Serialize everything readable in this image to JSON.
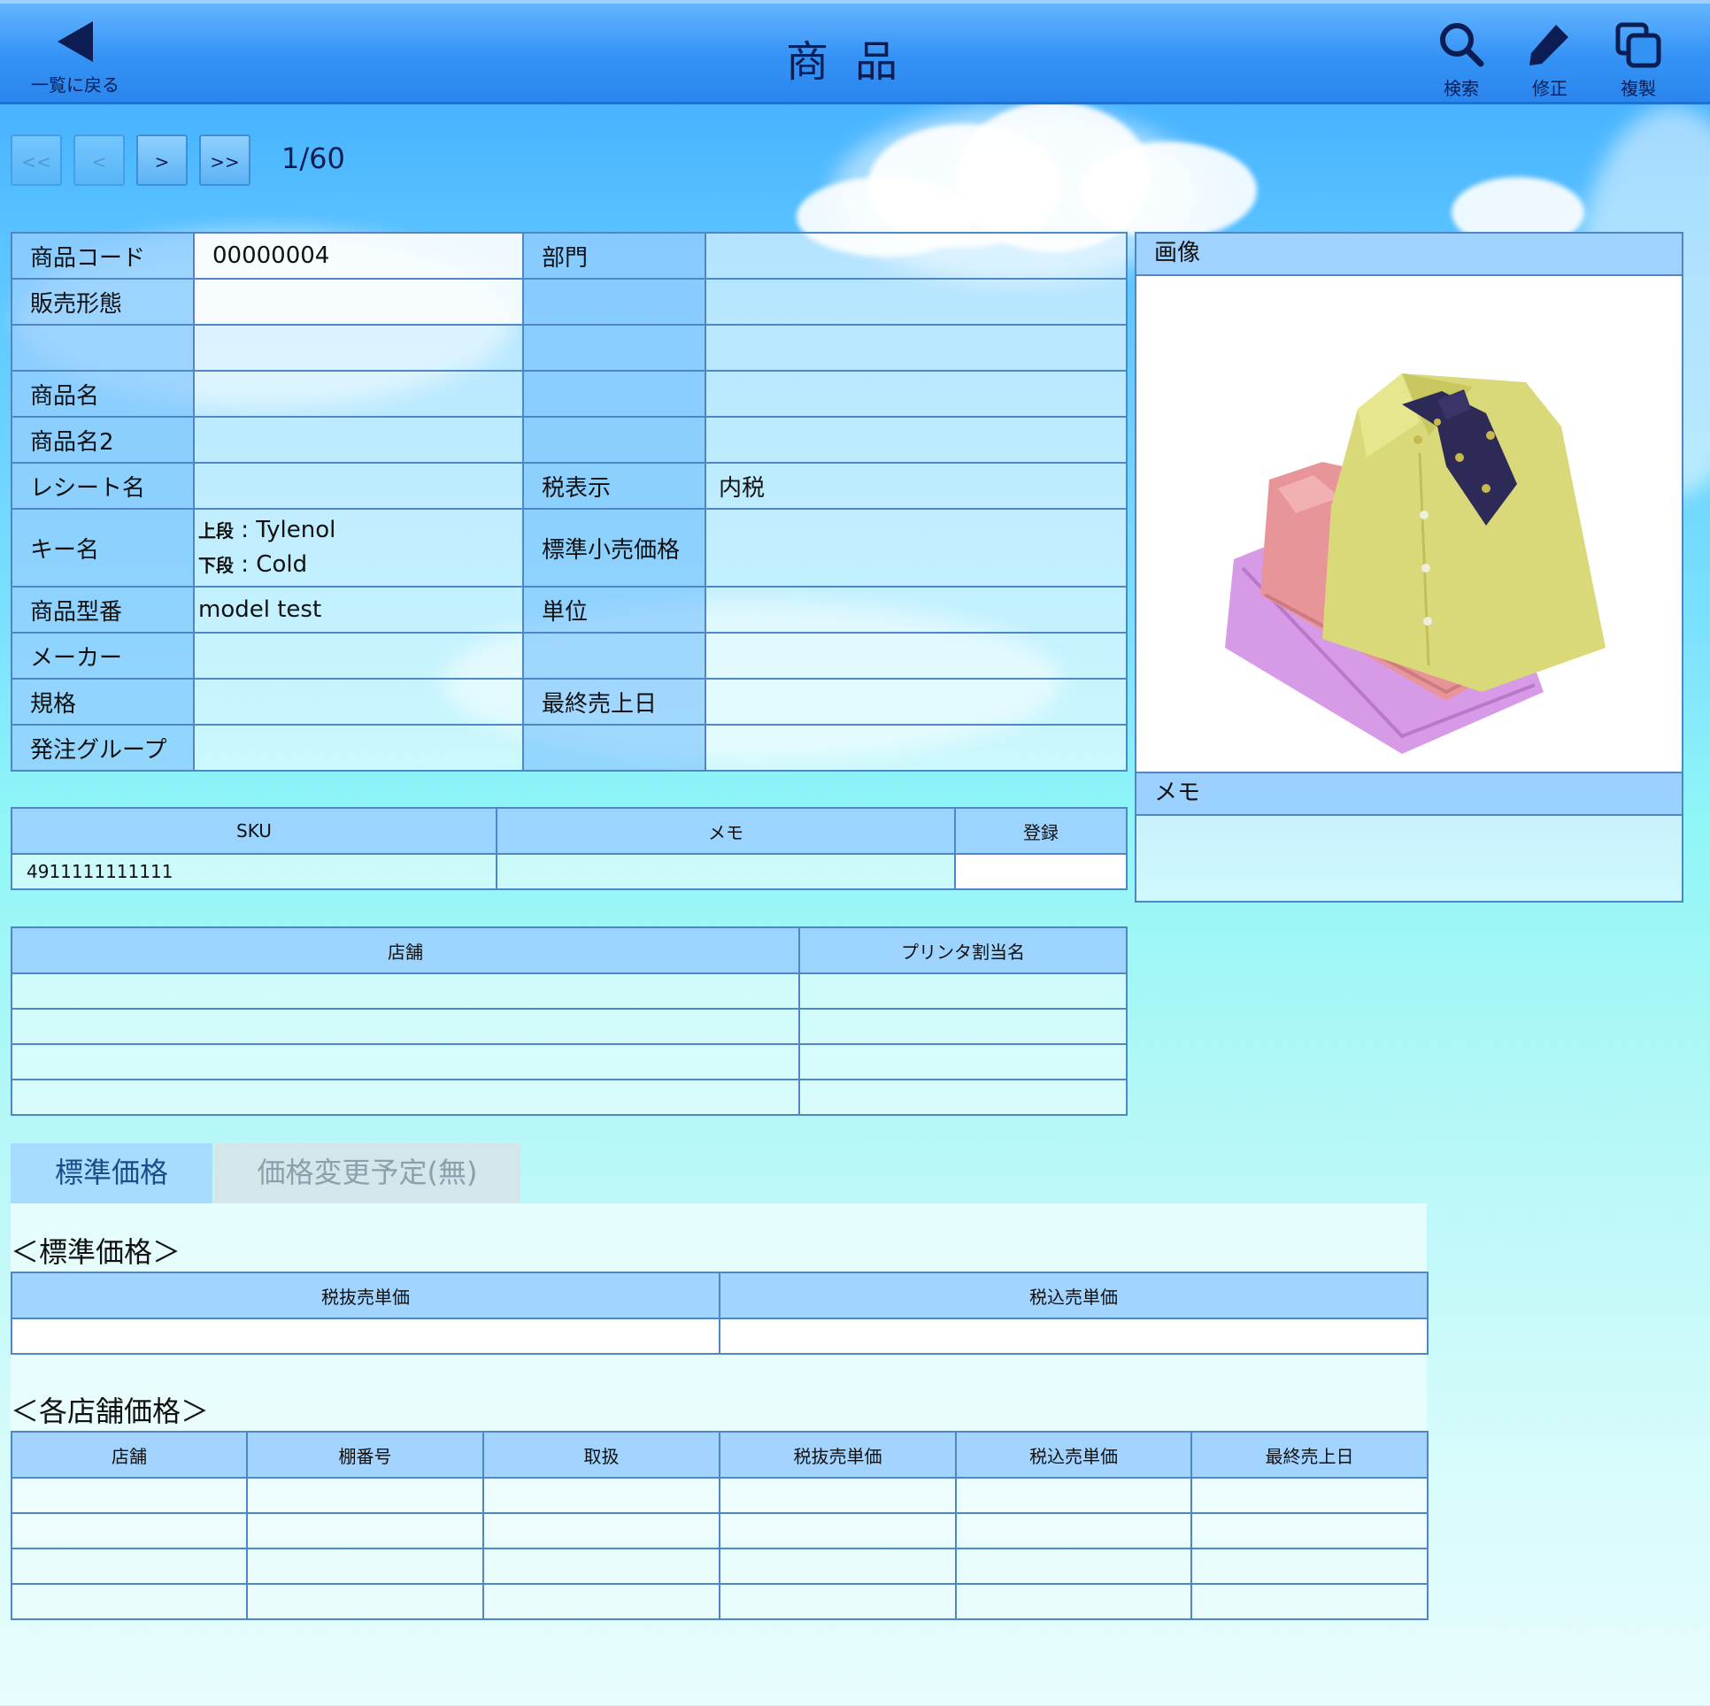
{
  "header": {
    "back_label": "一覧に戻る",
    "title": "商品",
    "search_label": "検索",
    "edit_label": "修正",
    "copy_label": "複製"
  },
  "pager": {
    "first": "<<",
    "prev": "<",
    "next": ">",
    "last": ">>",
    "count": "1/60"
  },
  "product": {
    "code_label": "商品コード",
    "code_value": "00000004",
    "dept_label": "部門",
    "dept_value": "",
    "sales_type_label": "販売形態",
    "name_label": "商品名",
    "name2_label": "商品名2",
    "receipt_label": "レシート名",
    "tax_label": "税表示",
    "tax_value": "内税",
    "key_label": "キー名",
    "key_upper_label": "上段",
    "key_upper_value": "Tylenol",
    "key_lower_label": "下段",
    "key_lower_value": "Cold",
    "std_price_label": "標準小売価格",
    "model_label": "商品型番",
    "model_value": "model test",
    "unit_label": "単位",
    "maker_label": "メーカー",
    "spec_label": "規格",
    "last_sale_label": "最終売上日",
    "order_group_label": "発注グループ"
  },
  "image_panel": {
    "title": "画像"
  },
  "memo_panel": {
    "title": "メモ"
  },
  "sku_table": {
    "headers": [
      "SKU",
      "メモ",
      "登録"
    ],
    "rows": [
      [
        "4911111111111",
        "",
        ""
      ]
    ]
  },
  "store_table": {
    "headers": [
      "店舗",
      "プリンタ割当名"
    ]
  },
  "tabs": {
    "standard": "標準価格",
    "change": "価格変更予定(無)"
  },
  "standard_price": {
    "title": "＜標準価格＞",
    "headers": [
      "税抜売単価",
      "税込売単価"
    ]
  },
  "store_price": {
    "title": "＜各店舗価格＞",
    "headers": [
      "店舗",
      "棚番号",
      "取扱",
      "税抜売単価",
      "税込売単価",
      "最終売上日"
    ]
  }
}
